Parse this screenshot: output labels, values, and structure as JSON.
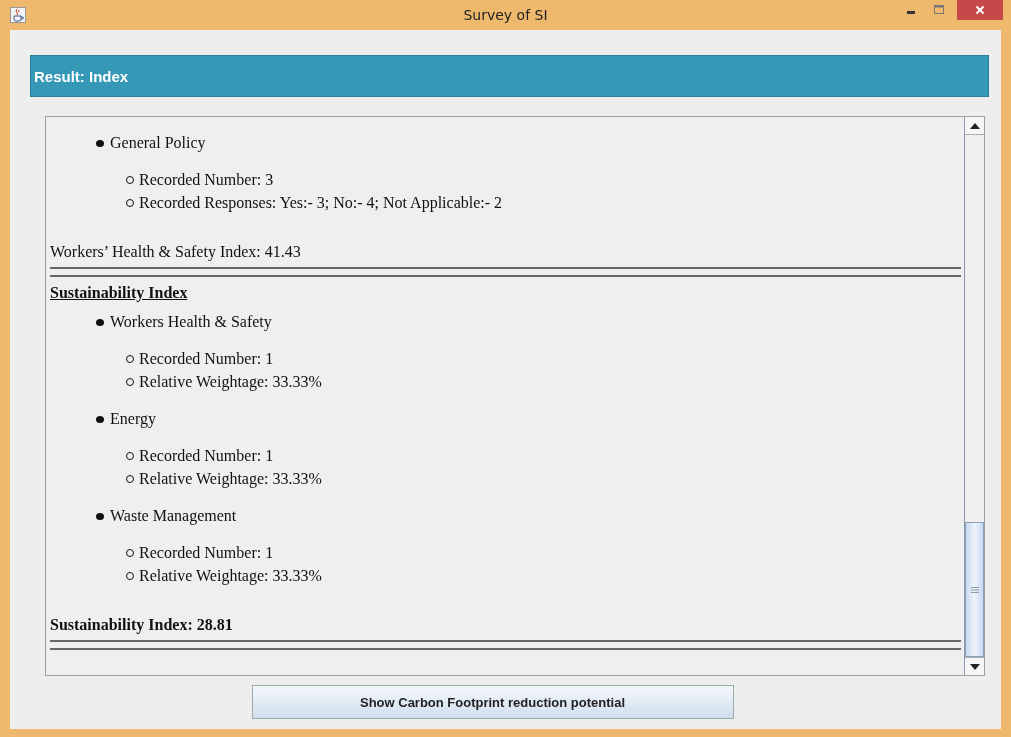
{
  "window": {
    "title": "Survey of SI"
  },
  "header": {
    "title": "Result: Index"
  },
  "report": [
    {
      "kind": "category",
      "label": "General Policy",
      "details": [
        "Recorded Number: 3",
        "Recorded Responses: Yes:- 3; No:- 4; Not Applicable:- 2"
      ]
    },
    {
      "kind": "index",
      "text": "Workers’ Health & Safety Index: 41.43",
      "bold": false
    },
    {
      "kind": "heading",
      "text": "Sustainability Index"
    },
    {
      "kind": "category",
      "label": "Workers Health & Safety",
      "details": [
        "Recorded Number: 1",
        "Relative Weightage: 33.33%"
      ]
    },
    {
      "kind": "category",
      "label": "Energy",
      "details": [
        "Recorded Number: 1",
        "Relative Weightage: 33.33%"
      ]
    },
    {
      "kind": "category",
      "label": "Waste Management",
      "details": [
        "Recorded Number: 1",
        "Relative Weightage: 33.33%"
      ]
    },
    {
      "kind": "index",
      "text": "Sustainability Index: 28.81",
      "bold": true
    }
  ],
  "buttons": [
    {
      "label": "Show Carbon Footprint reduction potential"
    }
  ]
}
